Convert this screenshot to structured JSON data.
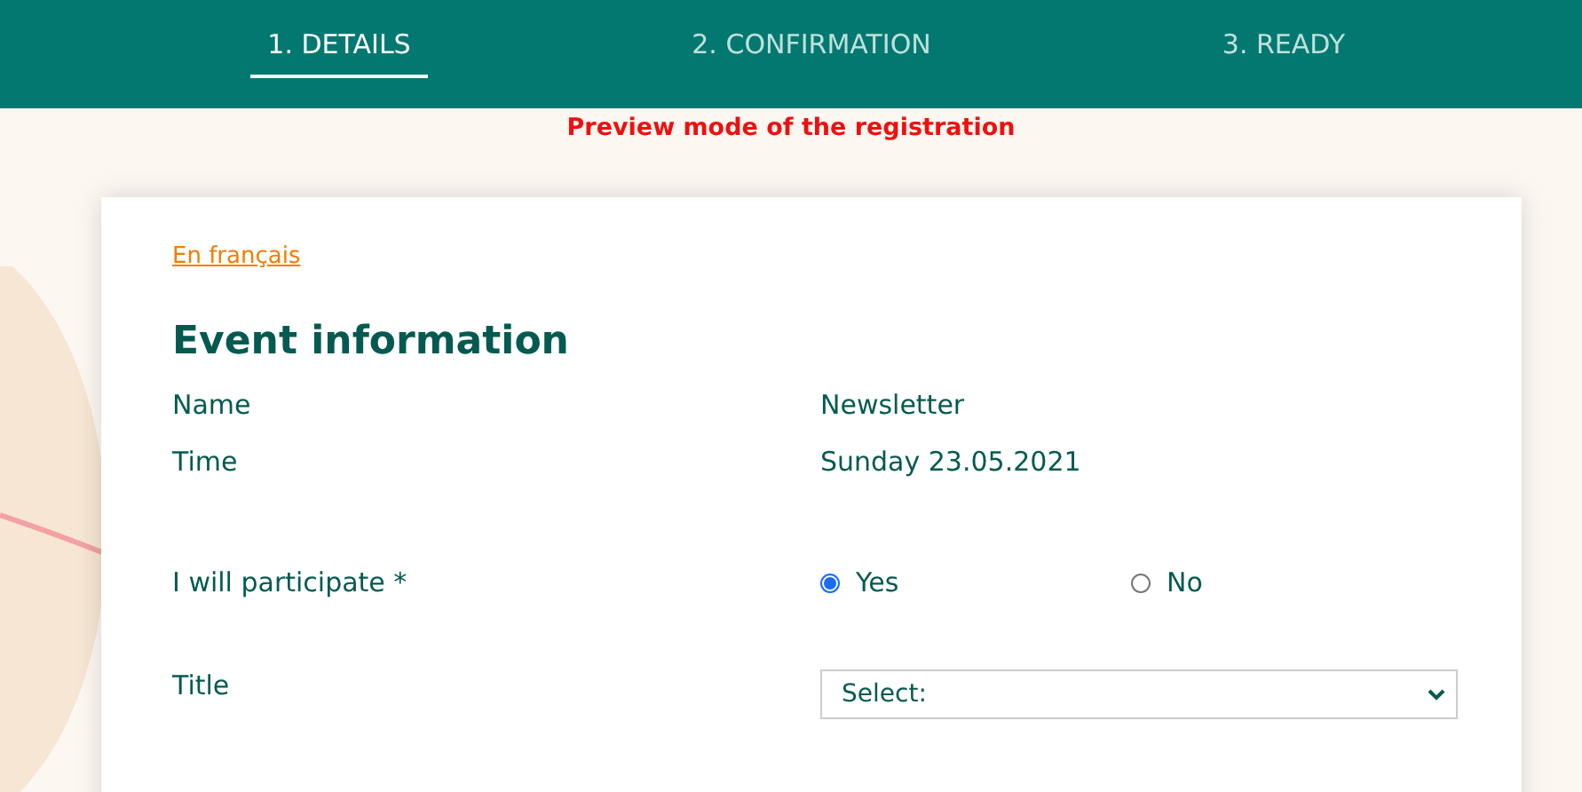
{
  "steps": [
    {
      "label": "1. DETAILS",
      "selected": true
    },
    {
      "label": "2. CONFIRMATION",
      "selected": false
    },
    {
      "label": "3. READY",
      "selected": false
    }
  ],
  "preview_notice": "Preview mode of the registration",
  "language_link": "En français",
  "section_title": "Event information",
  "info_rows": [
    {
      "label": "Name",
      "value": "Newsletter"
    },
    {
      "label": "Time",
      "value": "Sunday 23.05.2021"
    }
  ],
  "participate": {
    "label": "I will participate *",
    "options": [
      {
        "label": "Yes",
        "selected": true
      },
      {
        "label": "No",
        "selected": false
      }
    ]
  },
  "title_field": {
    "label": "Title",
    "value": "Select:"
  }
}
